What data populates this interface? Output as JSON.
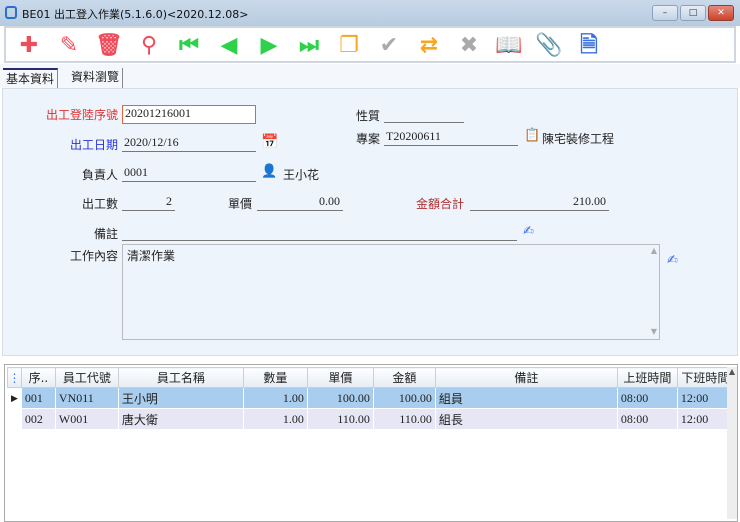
{
  "window": {
    "title": "BE01 出工登入作業(5.1.6.0)<2020.12.08>",
    "min": "–",
    "max": "□",
    "close": "✕"
  },
  "toolbar": [
    {
      "name": "new",
      "glyph": "✚",
      "color": "#ef4d5c"
    },
    {
      "name": "edit",
      "glyph": "✎",
      "color": "#ef4d5c"
    },
    {
      "name": "delete",
      "glyph": "🗑",
      "color": "#ef4d5c"
    },
    {
      "name": "search",
      "glyph": "⚲",
      "color": "#ef4d5c"
    },
    {
      "name": "first",
      "glyph": "⏮",
      "color": "#2ed24a"
    },
    {
      "name": "prev",
      "glyph": "◀",
      "color": "#2ed24a"
    },
    {
      "name": "next",
      "glyph": "▶",
      "color": "#2ed24a"
    },
    {
      "name": "last",
      "glyph": "⏭",
      "color": "#2ed24a"
    },
    {
      "name": "copy",
      "glyph": "❐",
      "color": "#f5a623"
    },
    {
      "name": "confirm",
      "glyph": "✔",
      "color": "#aaaaaa"
    },
    {
      "name": "refresh",
      "glyph": "⇄",
      "color": "#f5a623"
    },
    {
      "name": "cancel",
      "glyph": "✖",
      "color": "#aaaaaa"
    },
    {
      "name": "book",
      "glyph": "📖",
      "color": "#3a6fe0"
    },
    {
      "name": "attach",
      "glyph": "📎",
      "color": "#3a6fe0"
    },
    {
      "name": "export-xls",
      "glyph": "🗎",
      "color": "#3a6fe0"
    }
  ],
  "tabs": [
    "基本資料",
    "資料瀏覽"
  ],
  "form": {
    "serial_label": "出工登陸序號",
    "serial": "20201216001",
    "nature_label": "性質",
    "nature": "",
    "date_label": "出工日期",
    "date": "2020/12/16",
    "project_label": "專案",
    "project": "T20200611",
    "project_name": "陳宅裝修工程",
    "owner_label": "負責人",
    "owner": "0001",
    "owner_name": "王小花",
    "count_label": "出工數",
    "count": "2",
    "price_label": "單價",
    "price": "0.00",
    "total_label": "金額合計",
    "total": "210.00",
    "note_label": "備註",
    "note": "",
    "content_label": "工作內容",
    "content": "清潔作業"
  },
  "grid": {
    "headers": [
      "序..",
      "員工代號",
      "員工名稱",
      "數量",
      "單價",
      "金額",
      "備註",
      "上班時間",
      "下班時間"
    ],
    "rows": [
      [
        "001",
        "VN011",
        "王小明",
        "1.00",
        "100.00",
        "100.00",
        "組員",
        "08:00",
        "12:00"
      ],
      [
        "002",
        "W001",
        "唐大衛",
        "1.00",
        "110.00",
        "110.00",
        "組長",
        "08:00",
        "12:00"
      ]
    ]
  }
}
